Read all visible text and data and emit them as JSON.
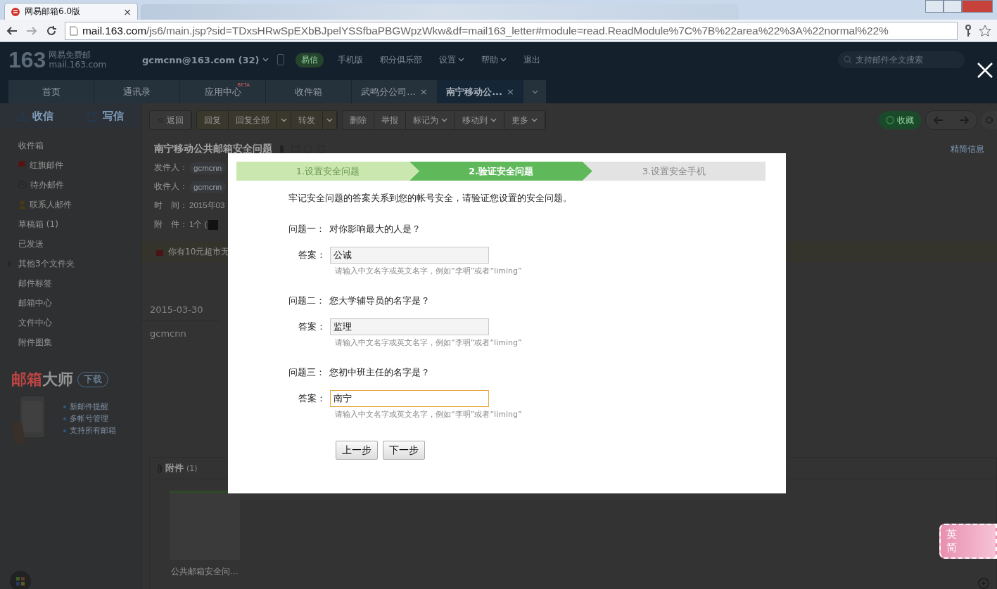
{
  "browser": {
    "tab": {
      "title": "网易邮箱6.0版",
      "close": "×"
    },
    "url": {
      "host": "mail.163.com",
      "path": "/js6/main.jsp?sid=TDxsHRwSpEXbBJpelYSSfbaPBGWpzWkw&df=mail163_letter#module=read.ReadModule%7C%7B%22area%22%3A%22normal%22%"
    }
  },
  "header": {
    "logo_number": "163",
    "logo_name": "网易免费邮",
    "logo_domain": "mail.163.com",
    "account": "gcmcnn@163.com (32)",
    "yixin": "易信",
    "search_placeholder": "支持邮件全文搜索",
    "links": [
      {
        "label": "手机版",
        "dropdown": false
      },
      {
        "label": "积分俱乐部",
        "dropdown": false
      },
      {
        "label": "设置",
        "dropdown": true
      },
      {
        "label": "帮助",
        "dropdown": true
      },
      {
        "label": "退出",
        "dropdown": false
      }
    ]
  },
  "tabs": [
    {
      "label": "首页",
      "selected": false
    },
    {
      "label": "通讯录",
      "selected": false
    },
    {
      "label": "应用中心",
      "badge": "BETA",
      "selected": false
    },
    {
      "label": "收件箱",
      "selected": false
    },
    {
      "label": "武鸣分公司...",
      "close": "×",
      "selected": false
    },
    {
      "label": "南宁移动公...",
      "close": "×",
      "selected": true
    }
  ],
  "sidebar": {
    "receive": "收信",
    "compose": "写信",
    "folders": [
      {
        "label": "收件箱",
        "kind": "plain"
      },
      {
        "label": "红旗邮件",
        "kind": "flag"
      },
      {
        "label": "待办邮件",
        "kind": "clock"
      },
      {
        "label": "联系人邮件",
        "kind": "contact"
      },
      {
        "label": "草稿箱 (1)",
        "kind": "plain"
      },
      {
        "label": "已发送",
        "kind": "plain"
      },
      {
        "label": "其他3个文件夹",
        "kind": "group"
      },
      {
        "label": "邮件标签",
        "kind": "plain"
      },
      {
        "label": "邮箱中心",
        "kind": "plain"
      },
      {
        "label": "文件中心",
        "kind": "plain"
      },
      {
        "label": "附件图集",
        "kind": "plain"
      }
    ],
    "promo": {
      "title_red": "邮箱",
      "title_rest": "大师",
      "download": "下载",
      "features": [
        "新邮件提醒",
        "多帐号管理",
        "支持所有邮箱"
      ]
    }
  },
  "toolbar": {
    "groups": [
      [
        {
          "label": "返回",
          "kind": "back"
        }
      ],
      [
        {
          "label": "回复",
          "kind": "plain"
        },
        {
          "label": "回复全部",
          "kind": "plain"
        },
        {
          "kind": "caret"
        },
        {
          "label": "转发",
          "kind": "plain"
        },
        {
          "kind": "caret"
        }
      ],
      [
        {
          "label": "删除",
          "kind": "plain"
        },
        {
          "label": "举报",
          "kind": "plain"
        },
        {
          "label": "标记为",
          "kind": "dropdown"
        },
        {
          "label": "移动到",
          "kind": "dropdown"
        },
        {
          "label": "更多",
          "kind": "dropdown"
        }
      ]
    ],
    "favorite": "收藏"
  },
  "message": {
    "subject": "南宁移动公共邮箱安全问题",
    "detail_toggle": "精简信息",
    "meta": [
      {
        "label": "发件人：",
        "value": "gcmcnn",
        "kind": "chip"
      },
      {
        "label": "收件人：",
        "value": "gcmcnn",
        "kind": "chip"
      },
      {
        "label": "时　间：",
        "value": "2015年03",
        "kind": "text"
      },
      {
        "label": "附　件：",
        "value": "1个 (",
        "kind": "file"
      }
    ],
    "notice": "你有10元超市无",
    "date": "2015-03-30",
    "signature": "gcmcnn",
    "attachments": {
      "title": "附件",
      "count": "(1)",
      "files": [
        {
          "name": "公共邮箱安全问..."
        }
      ]
    }
  },
  "dialog": {
    "steps": [
      {
        "label": "1.设置安全问题",
        "kind": "done"
      },
      {
        "label": "2.验证安全问题",
        "kind": "current"
      },
      {
        "label": "3.设置安全手机",
        "kind": "todo"
      }
    ],
    "intro": "牢记安全问题的答案关系到您的帐号安全，请验证您设置的安全问题。",
    "questions": [
      {
        "label": "问题一：",
        "question": "对你影响最大的人是？",
        "answer_label": "答案：",
        "answer": "公诚",
        "focused": false,
        "hint": "请输入中文名字或英文名字，例如“李明”或者“liming”"
      },
      {
        "label": "问题二：",
        "question": "您大学辅导员的名字是？",
        "answer_label": "答案：",
        "answer": "监理",
        "focused": false,
        "hint": "请输入中文名字或英文名字，例如“李明”或者“liming”"
      },
      {
        "label": "问题三：",
        "question": "您初中班主任的名字是？",
        "answer_label": "答案：",
        "answer": "南宁",
        "focused": true,
        "hint": "请输入中文名字或英文名字，例如“李明”或者“liming”"
      }
    ],
    "buttons": [
      {
        "label": "上一步"
      },
      {
        "label": "下一步"
      }
    ]
  },
  "ime": {
    "lang": "英",
    "script": "简"
  }
}
